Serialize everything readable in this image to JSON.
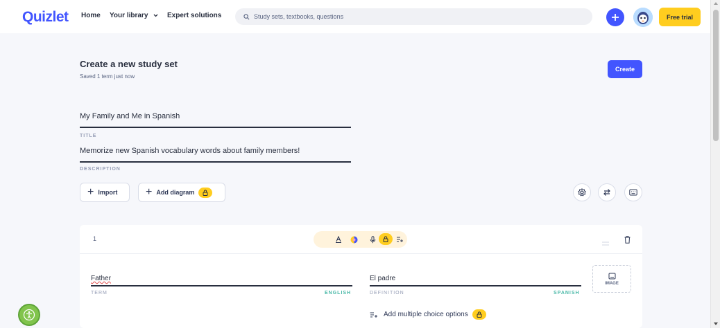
{
  "header": {
    "logo": "Quizlet",
    "nav": [
      "Home",
      "Your library",
      "Expert solutions"
    ],
    "search_placeholder": "Study sets, textbooks, questions",
    "free_trial": "Free trial"
  },
  "page": {
    "title": "Create a new study set",
    "saved_status": "Saved 1 term just now",
    "create_label": "Create"
  },
  "set": {
    "title_value": "My Family and Me in Spanish",
    "title_label": "TITLE",
    "description_value": "Memorize new Spanish vocabulary words about family members!",
    "description_label": "DESCRIPTION"
  },
  "actions": {
    "import_label": "Import",
    "add_diagram_label": "Add diagram"
  },
  "card": {
    "number": "1",
    "term_value": "Father",
    "term_label": "TERM",
    "term_lang": "ENGLISH",
    "definition_value": "El padre",
    "definition_label": "DEFINITION",
    "definition_lang": "SPANISH",
    "image_label": "IMAGE",
    "multiple_choice_label": "Add multiple choice options"
  },
  "colors": {
    "brand": "#4255ff",
    "accent_yellow": "#ffcd1f",
    "background": "#f6f7fb"
  }
}
